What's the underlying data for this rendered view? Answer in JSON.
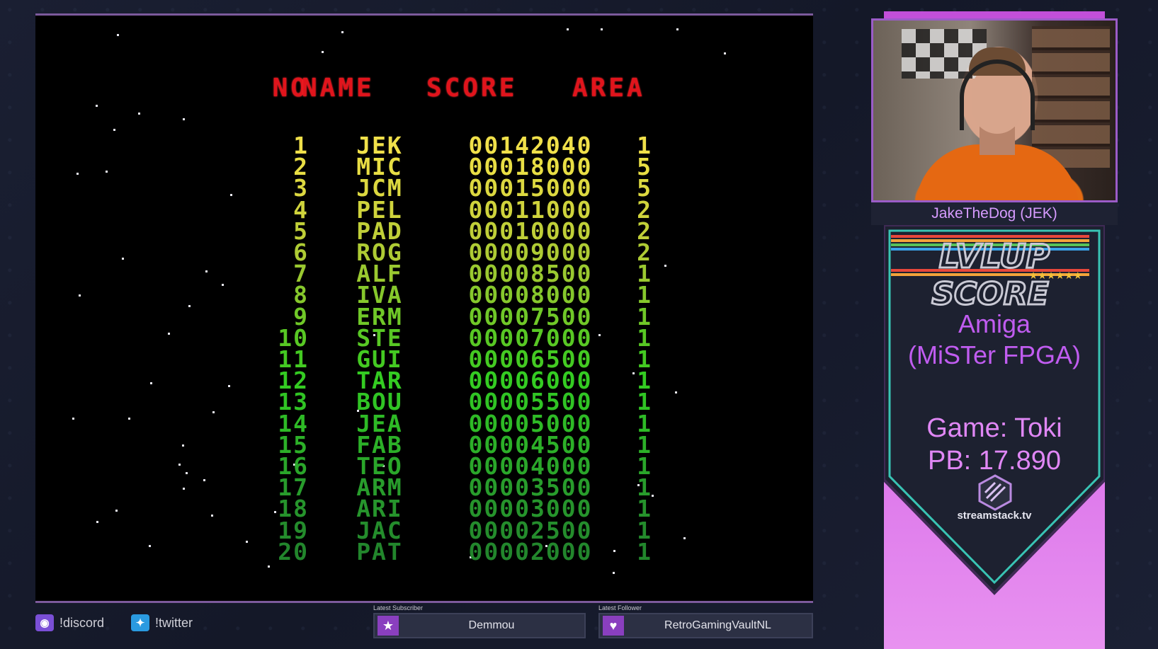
{
  "scoreboard": {
    "headers": {
      "no": "NO",
      "name": "NAME",
      "score": "SCORE",
      "area": "AREA"
    },
    "rows": [
      {
        "no": "1",
        "name": "JEK",
        "score": "00142040",
        "area": "1",
        "color": "#f0e04a"
      },
      {
        "no": "2",
        "name": "MIC",
        "score": "00018000",
        "area": "5",
        "color": "#e8de44"
      },
      {
        "no": "3",
        "name": "JCM",
        "score": "00015000",
        "area": "5",
        "color": "#dcd840"
      },
      {
        "no": "4",
        "name": "PEL",
        "score": "00011000",
        "area": "2",
        "color": "#cfd33c"
      },
      {
        "no": "5",
        "name": "PAD",
        "score": "00010000",
        "area": "2",
        "color": "#c0cf38"
      },
      {
        "no": "6",
        "name": "ROG",
        "score": "00009000",
        "area": "2",
        "color": "#aecb34"
      },
      {
        "no": "7",
        "name": "ALF",
        "score": "00008500",
        "area": "1",
        "color": "#9ac930"
      },
      {
        "no": "8",
        "name": "IVA",
        "score": "00008000",
        "area": "1",
        "color": "#86c82c"
      },
      {
        "no": "9",
        "name": "ERM",
        "score": "00007500",
        "area": "1",
        "color": "#70c828"
      },
      {
        "no": "10",
        "name": "STE",
        "score": "00007000",
        "area": "1",
        "color": "#58c824"
      },
      {
        "no": "11",
        "name": "GUI",
        "score": "00006500",
        "area": "1",
        "color": "#44ca22"
      },
      {
        "no": "12",
        "name": "TAR",
        "score": "00006000",
        "area": "1",
        "color": "#34cc22"
      },
      {
        "no": "13",
        "name": "BOU",
        "score": "00005500",
        "area": "1",
        "color": "#30c424"
      },
      {
        "no": "14",
        "name": "JEA",
        "score": "00005000",
        "area": "1",
        "color": "#2eba26"
      },
      {
        "no": "15",
        "name": "FAB",
        "score": "00004500",
        "area": "1",
        "color": "#2cb028"
      },
      {
        "no": "16",
        "name": "TEO",
        "score": "00004000",
        "area": "1",
        "color": "#2aa62a"
      },
      {
        "no": "17",
        "name": "ARM",
        "score": "00003500",
        "area": "1",
        "color": "#289c2c"
      },
      {
        "no": "18",
        "name": "ARI",
        "score": "00003000",
        "area": "1",
        "color": "#26942c"
      },
      {
        "no": "19",
        "name": "JAC",
        "score": "00002500",
        "area": "1",
        "color": "#248c2c"
      },
      {
        "no": "20",
        "name": "PAT",
        "score": "00002000",
        "area": "1",
        "color": "#22862c"
      }
    ]
  },
  "sidebar": {
    "streamer_name": "JakeTheDog (JEK)",
    "logo_line1": "LVLUP",
    "logo_line2": "SCORE",
    "logo_stars": "★★★★★★",
    "platform_line1": "Amiga",
    "platform_line2": "(MiSTer FPGA)",
    "game_line": "Game: Toki",
    "pb_line": "PB: 17.890",
    "sponsor": "streamstack.tv"
  },
  "footer": {
    "discord": "!discord",
    "twitter": "!twitter",
    "latest_subscriber_label": "Latest Subscriber",
    "latest_subscriber": "Demmou",
    "latest_follower_label": "Latest Follower",
    "latest_follower": "RetroGamingVaultNL"
  },
  "colors": {
    "header_red": "#e0141c",
    "accent_purple": "#c24fd9",
    "banner_teal": "#39c4b4"
  },
  "icons": {
    "discord": "discord-icon",
    "twitter": "twitter-icon",
    "subscriber": "star-icon",
    "follower": "heart-icon",
    "sponsor": "streamstack-hex-icon"
  }
}
